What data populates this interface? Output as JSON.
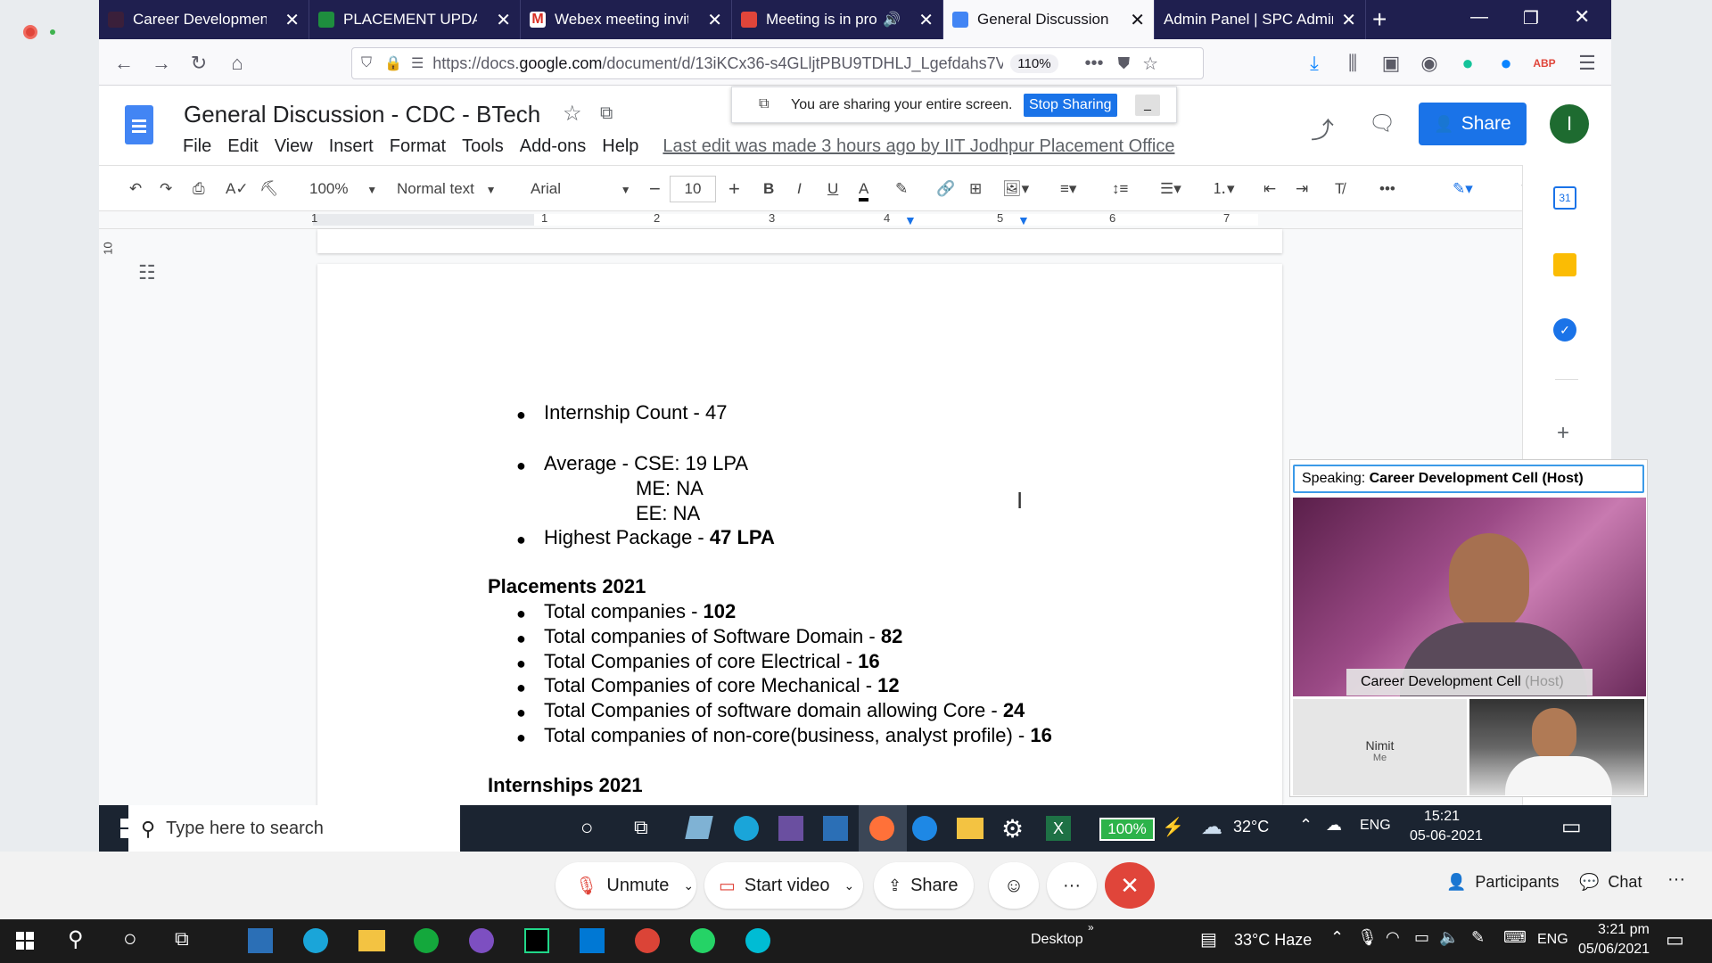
{
  "tabs": [
    {
      "title": "Career Development C",
      "icon": "webex-icon"
    },
    {
      "title": "PLACEMENT UPDATE",
      "icon": "sheets-icon"
    },
    {
      "title": "Webex meeting invitat",
      "icon": "gmail-icon"
    },
    {
      "title": "Meeting is in progr",
      "icon": "webex-meeting-icon"
    },
    {
      "title": "General Discussion - C",
      "icon": "docs-icon"
    },
    {
      "title": "Admin Panel | SPC Admini",
      "icon": "admin-icon"
    }
  ],
  "url": {
    "prefix": "https://docs.",
    "domain": "google.com",
    "path": "/document/d/13iKCx36-s4GLljtPBU9TDHLJ_Lgefdahs7V",
    "zoom": "110%"
  },
  "doc": {
    "title": "General Discussion - CDC - BTech",
    "menu": [
      "File",
      "Edit",
      "View",
      "Insert",
      "Format",
      "Tools",
      "Add-ons",
      "Help"
    ],
    "last_edit": "Last edit was made 3 hours ago by IIT Jodhpur Placement Office",
    "share_label": "Share",
    "avatar_letter": "I"
  },
  "sharebanner": {
    "text": "You are sharing your entire screen.",
    "stop": "Stop Sharing"
  },
  "toolbar": {
    "zoom": "100%",
    "style": "Normal text",
    "font": "Arial",
    "font_size": "10"
  },
  "ruler": {
    "ticks": [
      "1",
      "1",
      "2",
      "3",
      "4",
      "5",
      "6",
      "7"
    ],
    "side": "10"
  },
  "content": {
    "internship_count": "Internship Count - 47",
    "average": "Average - CSE: 19 LPA",
    "me": "ME: NA",
    "ee": "EE: NA",
    "highest_prefix": "Highest Package - ",
    "highest_value": "47 LPA",
    "placements_heading": "Placements 2021",
    "placements": [
      {
        "label": "Total companies - ",
        "value": "102"
      },
      {
        "label": "Total companies of Software Domain - ",
        "value": "82"
      },
      {
        "label": "Total Companies of core Electrical - ",
        "value": "16"
      },
      {
        "label": "Total Companies of core Mechanical - ",
        "value": "12"
      },
      {
        "label": "Total Companies of software domain allowing Core - ",
        "value": "24"
      },
      {
        "label": "Total companies of non-core(business, analyst profile) - ",
        "value": "16"
      }
    ],
    "internships_heading": "Internships 2021"
  },
  "webex_panel": {
    "speaking_label": "Speaking: ",
    "speaker": "Career Development Cell (Host)",
    "host_name": "Career Development Cell",
    "host_tag": " (Host)",
    "self_name": "Nimit",
    "self_tag": "Me"
  },
  "inner_taskbar": {
    "search": "Type here to search",
    "battery": "100%",
    "temp": "32°C",
    "lang": "ENG",
    "time": "15:21",
    "date": "05-06-2021"
  },
  "webex_controls": {
    "unmute": "Unmute",
    "video": "Start video",
    "share": "Share",
    "participants": "Participants",
    "chat": "Chat"
  },
  "outer_taskbar": {
    "desktop": "Desktop",
    "weather": "33°C Haze",
    "lang": "ENG",
    "time": "3:21 pm",
    "date": "05/06/2021"
  },
  "colors": {
    "tabbar": "#1f1f4f",
    "docs_blue": "#1a73e8",
    "end_call": "#e0453a",
    "avatar": "#1e6b30"
  }
}
